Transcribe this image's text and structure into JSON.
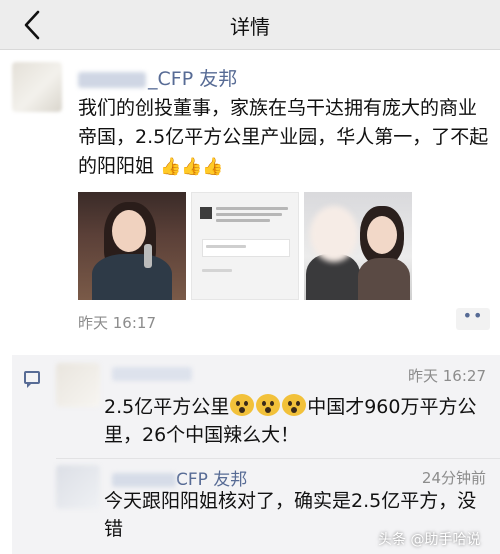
{
  "nav": {
    "title": "详情"
  },
  "post": {
    "author_suffix": "_CFP 友邦",
    "text": "我们的创投董事，家族在乌干达拥有庞大的商业帝国，2.5亿平方公里产业园，华人第一，了不起的阳阳姐",
    "time": "昨天 16:17",
    "more_label": "••",
    "photos": [
      "photo-speaker",
      "photo-chat-screenshot",
      "photo-two-women"
    ]
  },
  "comments": [
    {
      "time": "昨天 16:27",
      "text_part1": "2.5亿平方公里",
      "text_part2": "中国才960万平方公里，26个中国辣么大！"
    },
    {
      "author_suffix": "CFP 友邦",
      "time": "24分钟前",
      "text": "今天跟阳阳姐核对了，确实是2.5亿平方，没错"
    }
  ],
  "watermark": "头条 @助手哈说",
  "colors": {
    "nav_bg": "#ededed",
    "link": "#576b95",
    "comment_bg": "#f3f3f5",
    "meta": "#8c8c8c"
  },
  "icons": [
    "back-chevron-icon",
    "thumbs-up-icon",
    "comment-icon",
    "scream-emoji-icon"
  ]
}
